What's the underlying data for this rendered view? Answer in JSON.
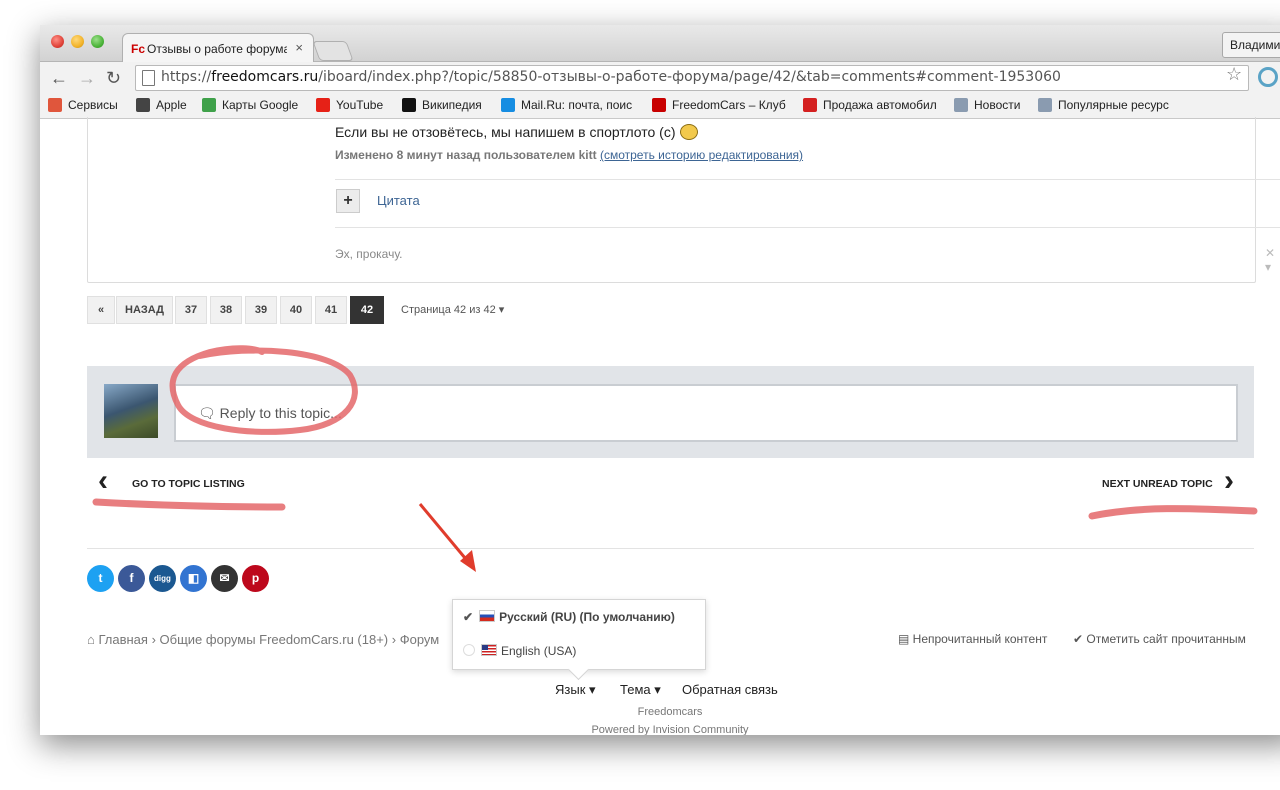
{
  "browser": {
    "tab_title": "Отзывы о работе форума",
    "tab_close": "×",
    "favicon_text": "Fc",
    "user_button": "Владимир",
    "back": "←",
    "forward": "→",
    "reload": "↻",
    "url_prefix": "https://",
    "url_domain": "freedomcars.ru",
    "url_path": "/iboard/index.php?/topic/58850-отзывы-о-работе-форума/page/42/&tab=comments#comment-1953060",
    "star": "☆"
  },
  "bookmarks": [
    {
      "label": "Сервисы",
      "color": "#e0563c"
    },
    {
      "label": "Apple",
      "color": "#444444"
    },
    {
      "label": "Карты Google",
      "color": "#3fa14a"
    },
    {
      "label": "YouTube",
      "color": "#e62117"
    },
    {
      "label": "Википедия",
      "color": "#111111"
    },
    {
      "label": "Mail.Ru: почта, поис",
      "color": "#168de2"
    },
    {
      "label": "FreedomCars – Клуб",
      "color": "#c80000"
    },
    {
      "label": "Продажа автомобил",
      "color": "#d42020"
    },
    {
      "label": "Новости",
      "color": "#8a9bb0"
    },
    {
      "label": "Популярные ресурс",
      "color": "#8a9bb0"
    }
  ],
  "post": {
    "text": "Если вы не отзовётесь, мы напишем в спортлото (с)",
    "edited_prefix": "Изменено 8 минут назад пользователем kitt",
    "edited_link": "(смотреть историю редактирования)",
    "quote_plus": "+",
    "quote_label": "Цитата",
    "signature": "Эх, прокачу.",
    "sig_controls": "✕ ▾"
  },
  "pagination": {
    "first": "«",
    "back": "НАЗАД",
    "pages": [
      "37",
      "38",
      "39",
      "40",
      "41",
      "42"
    ],
    "active": "42",
    "info": "Страница 42 из 42 ▾"
  },
  "reply": {
    "placeholder": "Reply to this topic..."
  },
  "nav": {
    "prev_label": "GO TO TOPIC LISTING",
    "next_label": "NEXT UNREAD TOPIC",
    "prev_chev": "‹",
    "next_chev": "›"
  },
  "share": [
    {
      "name": "twitter",
      "glyph": "t",
      "color": "#1da1f2"
    },
    {
      "name": "facebook",
      "glyph": "f",
      "color": "#3b5998"
    },
    {
      "name": "digg",
      "glyph": "digg",
      "color": "#1b5891"
    },
    {
      "name": "delicious",
      "glyph": "◧",
      "color": "#3274d1"
    },
    {
      "name": "email",
      "glyph": "✉",
      "color": "#333333"
    },
    {
      "name": "pinterest",
      "glyph": "p",
      "color": "#bd081c"
    }
  ],
  "breadcrumb": {
    "home": "Главная",
    "sep1": "›",
    "forum": "Общие форумы FreedomCars.ru (18+)",
    "sep2": "›",
    "sub": "Форум"
  },
  "footer_actions": {
    "unread": "Непрочитанный контент",
    "mark_read": "Отметить сайт прочитанным"
  },
  "language_menu": {
    "items": [
      {
        "label": "Русский (RU) (По умолчанию)",
        "selected": true
      },
      {
        "label": "English (USA)",
        "selected": false
      }
    ]
  },
  "footer": {
    "language": "Язык ▾",
    "theme": "Тема ▾",
    "feedback": "Обратная связь",
    "site_name": "Freedomcars",
    "powered": "Powered by Invision Community"
  },
  "colors": {
    "accent_link": "#3d6594",
    "annotation": "#e4676a",
    "arrow": "#e03c2c"
  }
}
